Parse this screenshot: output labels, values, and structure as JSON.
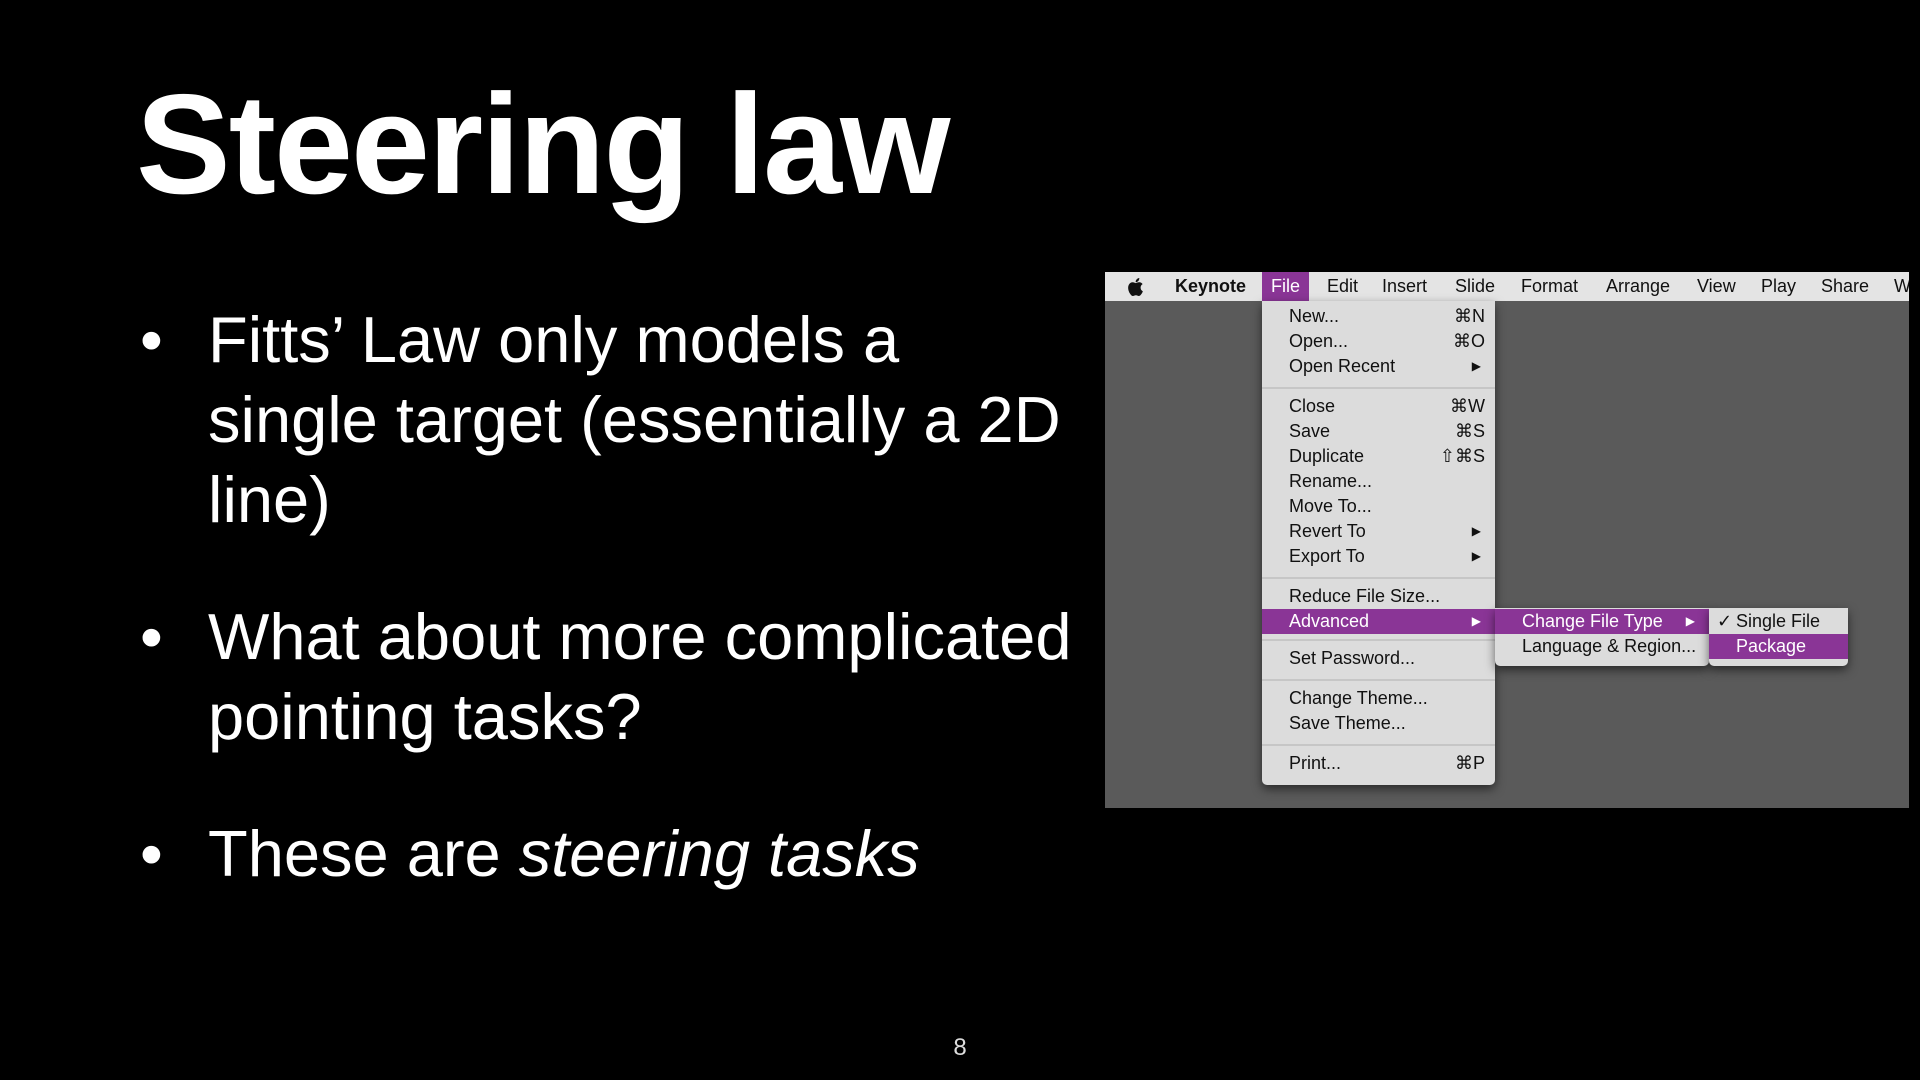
{
  "slide": {
    "title": "Steering law",
    "bullets": [
      {
        "text": "Fitts’ Law only models a single target (essentially a 2D line)"
      },
      {
        "text": "What about more complicated pointing tasks?"
      },
      {
        "text_prefix": "These are ",
        "text_italic": "steering tasks"
      }
    ],
    "bullet_glyph": "•",
    "page_number": "8"
  },
  "screenshot": {
    "menubar": {
      "apple_icon": "apple-logo-icon",
      "app_name": "Keynote",
      "items": [
        "File",
        "Edit",
        "Insert",
        "Slide",
        "Format",
        "Arrange",
        "View",
        "Play",
        "Share",
        "W"
      ]
    },
    "file_menu": {
      "items": [
        {
          "label": "New...",
          "shortcut": "⌘N"
        },
        {
          "label": "Open...",
          "shortcut": "⌘O"
        },
        {
          "label": "Open Recent",
          "shortcut": "▶"
        },
        {
          "label": "Close",
          "shortcut": "⌘W"
        },
        {
          "label": "Save",
          "shortcut": "⌘S"
        },
        {
          "label": "Duplicate",
          "shortcut": "⇧⌘S"
        },
        {
          "label": "Rename...",
          "shortcut": ""
        },
        {
          "label": "Move To...",
          "shortcut": ""
        },
        {
          "label": "Revert To",
          "shortcut": "▶"
        },
        {
          "label": "Export To",
          "shortcut": "▶"
        },
        {
          "label": "Reduce File Size...",
          "shortcut": ""
        },
        {
          "label": "Advanced",
          "shortcut": "▶"
        },
        {
          "label": "Set Password...",
          "shortcut": ""
        },
        {
          "label": "Change Theme...",
          "shortcut": ""
        },
        {
          "label": "Save Theme...",
          "shortcut": ""
        },
        {
          "label": "Print...",
          "shortcut": "⌘P"
        }
      ]
    },
    "advanced_menu": {
      "items": [
        {
          "label": "Change File Type",
          "shortcut": "▶"
        },
        {
          "label": "Language & Region...",
          "shortcut": ""
        }
      ]
    },
    "file_type_menu": {
      "checkmark": "✓",
      "items": [
        {
          "label": "Single File"
        },
        {
          "label": "Package"
        }
      ]
    },
    "colors": {
      "highlight": "#8a3596",
      "menu_bg": "#dcdcdc",
      "menubar_bg": "#e4e4e4"
    }
  }
}
